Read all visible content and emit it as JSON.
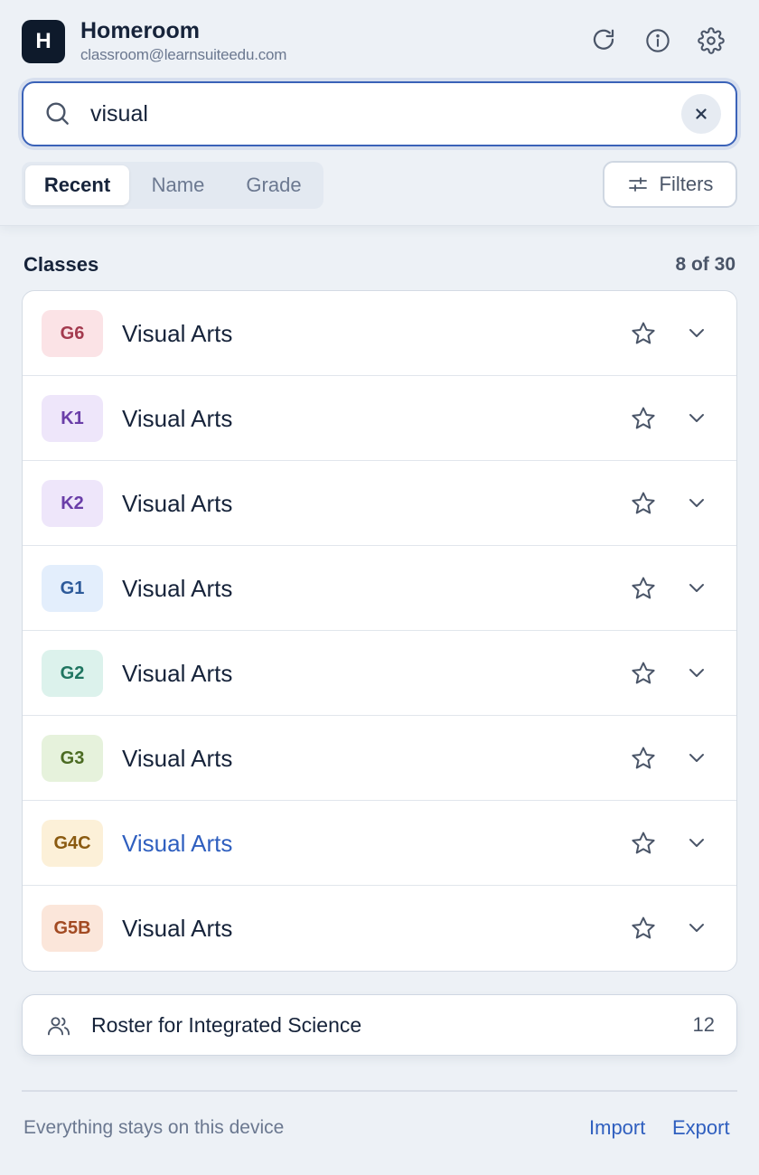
{
  "header": {
    "logo_letter": "H",
    "title": "Homeroom",
    "email": "classroom@learnsuiteedu.com",
    "icons": [
      "refresh-icon",
      "info-icon",
      "gear-icon"
    ]
  },
  "search": {
    "value": "visual",
    "placeholder": "Search classes"
  },
  "sort_tabs": [
    {
      "label": "Recent",
      "active": true
    },
    {
      "label": "Name",
      "active": false
    },
    {
      "label": "Grade",
      "active": false
    }
  ],
  "filters_label": "Filters",
  "section": {
    "title": "Classes",
    "count": "8 of 30"
  },
  "classes": [
    {
      "grade": "G6",
      "name": "Visual Arts",
      "badge_bg": "#fbe3e6",
      "badge_fg": "#a33a4e"
    },
    {
      "grade": "K1",
      "name": "Visual Arts",
      "badge_bg": "#eee6fa",
      "badge_fg": "#6a3ea8"
    },
    {
      "grade": "K2",
      "name": "Visual Arts",
      "badge_bg": "#eee6fa",
      "badge_fg": "#6a3ea8"
    },
    {
      "grade": "G1",
      "name": "Visual Arts",
      "badge_bg": "#e3eefc",
      "badge_fg": "#2d5a9a"
    },
    {
      "grade": "G2",
      "name": "Visual Arts",
      "badge_bg": "#dcf2ec",
      "badge_fg": "#1f7560"
    },
    {
      "grade": "G3",
      "name": "Visual Arts",
      "badge_bg": "#e6f2dc",
      "badge_fg": "#4b6b22"
    },
    {
      "grade": "G4C",
      "name": "Visual Arts",
      "badge_bg": "#fcf0d8",
      "badge_fg": "#8a5a10",
      "highlight": true
    },
    {
      "grade": "G5B",
      "name": "Visual Arts",
      "badge_bg": "#fbe6da",
      "badge_fg": "#a24a22"
    }
  ],
  "roster": {
    "label": "Roster for Integrated Science",
    "count": "12"
  },
  "footer": {
    "note": "Everything stays on this device",
    "import_label": "Import",
    "export_label": "Export"
  },
  "colors": {
    "accent": "#2f5fbf",
    "search_border": "#3a62b8",
    "background": "#edf1f6"
  }
}
